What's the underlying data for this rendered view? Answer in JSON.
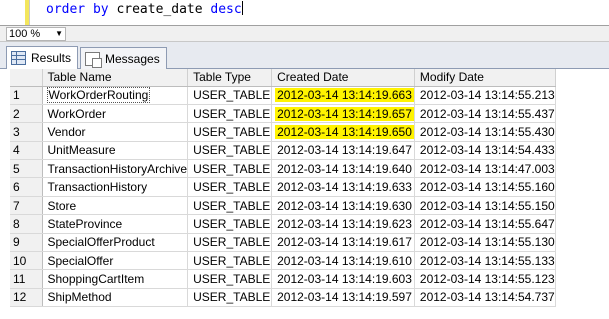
{
  "editor": {
    "keyword1": "order",
    "keyword2": "by",
    "identifier": "create_date",
    "keyword3": "desc"
  },
  "zoom": {
    "value": "100 %"
  },
  "tabs": [
    {
      "label": "Results",
      "icon": "grid-icon",
      "active": true
    },
    {
      "label": "Messages",
      "icon": "messages-icon",
      "active": false
    }
  ],
  "grid": {
    "columns": [
      "",
      "Table Name",
      "Table Type",
      "Created Date",
      "Modify Date"
    ],
    "rows": [
      [
        "1",
        "WorkOrderRouting",
        "USER_TABLE",
        "2012-03-14 13:14:19.663",
        "2012-03-14 13:14:55.213"
      ],
      [
        "2",
        "WorkOrder",
        "USER_TABLE",
        "2012-03-14 13:14:19.657",
        "2012-03-14 13:14:55.437"
      ],
      [
        "3",
        "Vendor",
        "USER_TABLE",
        "2012-03-14 13:14:19.650",
        "2012-03-14 13:14:55.430"
      ],
      [
        "4",
        "UnitMeasure",
        "USER_TABLE",
        "2012-03-14 13:14:19.647",
        "2012-03-14 13:14:54.433"
      ],
      [
        "5",
        "TransactionHistoryArchive",
        "USER_TABLE",
        "2012-03-14 13:14:19.640",
        "2012-03-14 13:14:47.003"
      ],
      [
        "6",
        "TransactionHistory",
        "USER_TABLE",
        "2012-03-14 13:14:19.633",
        "2012-03-14 13:14:55.160"
      ],
      [
        "7",
        "Store",
        "USER_TABLE",
        "2012-03-14 13:14:19.630",
        "2012-03-14 13:14:55.150"
      ],
      [
        "8",
        "StateProvince",
        "USER_TABLE",
        "2012-03-14 13:14:19.623",
        "2012-03-14 13:14:55.647"
      ],
      [
        "9",
        "SpecialOfferProduct",
        "USER_TABLE",
        "2012-03-14 13:14:19.617",
        "2012-03-14 13:14:55.130"
      ],
      [
        "10",
        "SpecialOffer",
        "USER_TABLE",
        "2012-03-14 13:14:19.610",
        "2012-03-14 13:14:55.133"
      ],
      [
        "11",
        "ShoppingCartItem",
        "USER_TABLE",
        "2012-03-14 13:14:19.603",
        "2012-03-14 13:14:55.123"
      ],
      [
        "12",
        "ShipMethod",
        "USER_TABLE",
        "2012-03-14 13:14:19.597",
        "2012-03-14 13:14:54.737"
      ]
    ],
    "highlighted_rows": [
      0,
      1,
      2
    ],
    "highlight_color": "#fff300"
  }
}
